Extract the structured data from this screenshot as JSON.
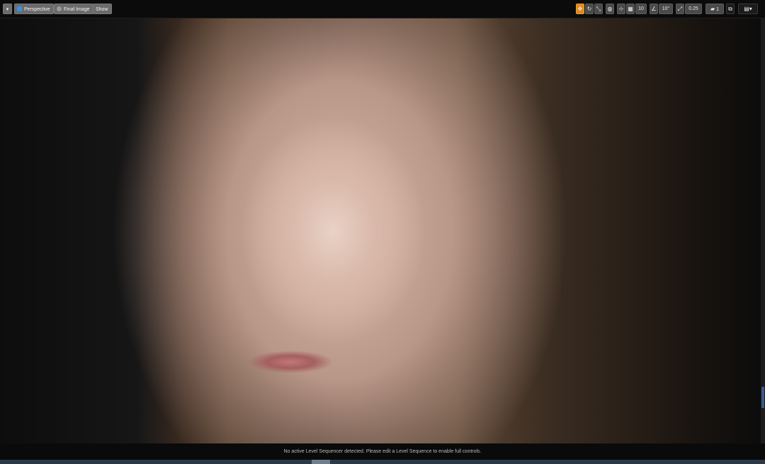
{
  "toolbar": {
    "menu_glyph": "▾",
    "perspective_label": "Perspective",
    "final_image_label": "Final Image",
    "show_label": "Show",
    "grid_snap_value": "10",
    "rotation_snap_value": "10°",
    "scale_snap_value": "0.25",
    "camera_speed_value": "1",
    "icons": {
      "select": "arrows-icon",
      "rotate": "rotate-icon",
      "scale": "scale-icon",
      "world": "globe-icon",
      "surface_snap": "surface-snap-icon",
      "grid": "grid-icon",
      "rotation": "angle-icon",
      "scale_snap": "scale-snap-icon",
      "camera": "camera-icon",
      "maximize": "maximize-icon",
      "layout": "layout-icon"
    }
  },
  "status": {
    "message": "No active Level Sequencer detected. Please edit a Level Sequence to enable full controls."
  },
  "colors": {
    "accent_selected": "#e08a1e",
    "perspective_icon": "#3c8fe0"
  }
}
